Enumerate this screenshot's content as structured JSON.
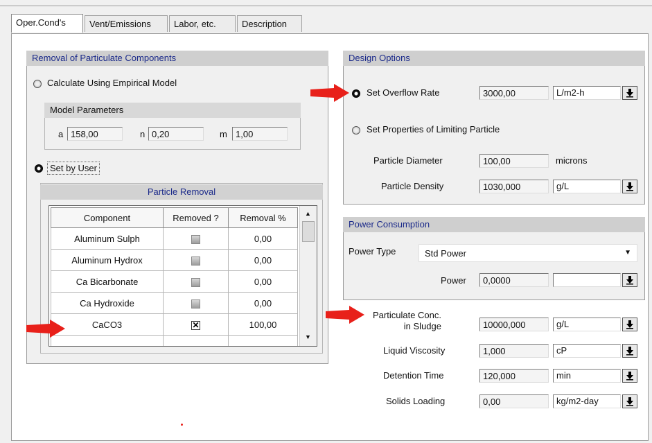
{
  "tabs": [
    "Oper.Cond's",
    "Vent/Emissions",
    "Labor, etc.",
    "Description"
  ],
  "removal": {
    "title": "Removal of Particulate Components",
    "empirical_label": "Calculate Using Empirical Model",
    "model_params_title": "Model Parameters",
    "a_label": "a",
    "a_value": "158,00",
    "n_label": "n",
    "n_value": "0,20",
    "m_label": "m",
    "m_value": "1,00",
    "set_by_user_label": "Set by User",
    "particle_removal_title": "Particle Removal",
    "columns": [
      "Component",
      "Removed ?",
      "Removal %"
    ],
    "rows": [
      {
        "component": "Aluminum Sulph",
        "removed": false,
        "pct": "0,00"
      },
      {
        "component": "Aluminum Hydrox",
        "removed": false,
        "pct": "0,00"
      },
      {
        "component": "Ca Bicarbonate",
        "removed": false,
        "pct": "0,00"
      },
      {
        "component": "Ca Hydroxide",
        "removed": false,
        "pct": "0,00"
      },
      {
        "component": "CaCO3",
        "removed": true,
        "pct": "100,00"
      }
    ]
  },
  "design": {
    "title": "Design Options",
    "overflow_label": "Set Overflow Rate",
    "overflow_value": "3000,00",
    "overflow_unit": "L/m2-h",
    "limiting_label": "Set Properties of Limiting Particle",
    "diameter_label": "Particle Diameter",
    "diameter_value": "100,00",
    "diameter_unit": "microns",
    "density_label": "Particle Density",
    "density_value": "1030,000",
    "density_unit": "g/L"
  },
  "power": {
    "title": "Power Consumption",
    "type_label": "Power Type",
    "type_value": "Std Power",
    "power_label": "Power",
    "power_value": "0,0000",
    "power_unit": ""
  },
  "params": [
    {
      "label": "Particulate Conc.\nin Sludge",
      "value": "10000,000",
      "unit": "g/L"
    },
    {
      "label": "Liquid Viscosity",
      "value": "1,000",
      "unit": "cP"
    },
    {
      "label": "Detention Time",
      "value": "120,000",
      "unit": "min"
    },
    {
      "label": "Solids Loading",
      "value": "0,00",
      "unit": "kg/m2-day"
    }
  ],
  "colors": {
    "section_header_text": "#1b2a8a",
    "section_header_bg": "#cfcfcf",
    "annotation_arrow": "#e8201a"
  },
  "icons": {
    "dropdown": "down-arrow-icon",
    "annotation": "red-arrow-icon"
  }
}
